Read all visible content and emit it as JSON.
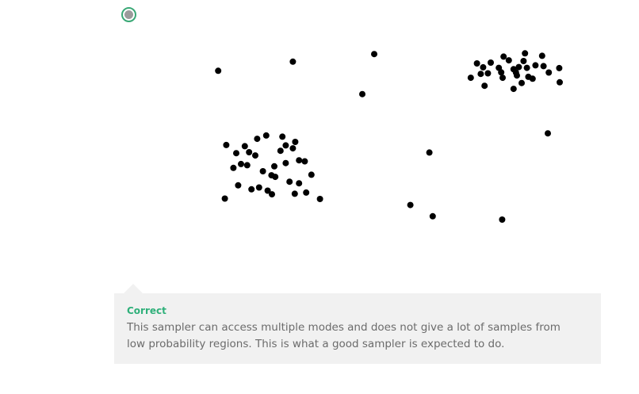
{
  "option": {
    "selected": true,
    "ring_color": "#3aa876",
    "fill_color": "#9b9b9b"
  },
  "chart_data": {
    "type": "scatter",
    "title": "",
    "xlabel": "",
    "ylabel": "",
    "xlim": [
      0,
      100
    ],
    "ylim": [
      0,
      100
    ],
    "grid": false,
    "axes_visible": false,
    "point_color": "#000000",
    "points": [
      [
        19.2,
        86.0
      ],
      [
        34.9,
        90.7
      ],
      [
        52.0,
        94.6
      ],
      [
        49.5,
        74.0
      ],
      [
        90.9,
        87.4
      ],
      [
        88.5,
        53.8
      ],
      [
        63.6,
        43.9
      ],
      [
        64.3,
        11.1
      ],
      [
        78.9,
        9.4
      ],
      [
        59.6,
        16.9
      ],
      [
        83.7,
        95.0
      ],
      [
        87.3,
        93.7
      ],
      [
        79.2,
        93.3
      ],
      [
        73.6,
        89.8
      ],
      [
        76.5,
        90.2
      ],
      [
        80.3,
        91.4
      ],
      [
        83.4,
        91.0
      ],
      [
        87.6,
        88.4
      ],
      [
        74.9,
        87.8
      ],
      [
        78.2,
        87.5
      ],
      [
        81.3,
        86.8
      ],
      [
        82.4,
        87.9
      ],
      [
        84.1,
        87.5
      ],
      [
        85.9,
        88.8
      ],
      [
        75.9,
        84.7
      ],
      [
        74.4,
        84.4
      ],
      [
        78.7,
        85.2
      ],
      [
        81.8,
        85.1
      ],
      [
        84.4,
        82.9
      ],
      [
        88.7,
        85.1
      ],
      [
        72.3,
        82.4
      ],
      [
        79.0,
        82.4
      ],
      [
        85.3,
        81.9
      ],
      [
        82.0,
        83.6
      ],
      [
        91.0,
        80.1
      ],
      [
        75.2,
        78.3
      ],
      [
        81.3,
        76.7
      ],
      [
        83.0,
        79.7
      ],
      [
        23.0,
        43.6
      ],
      [
        27.4,
        51.0
      ],
      [
        29.3,
        52.7
      ],
      [
        32.7,
        52.1
      ],
      [
        35.4,
        49.4
      ],
      [
        20.9,
        47.8
      ],
      [
        24.8,
        47.2
      ],
      [
        33.4,
        47.6
      ],
      [
        27.0,
        42.4
      ],
      [
        32.3,
        44.8
      ],
      [
        34.9,
        46.1
      ],
      [
        37.4,
        39.4
      ],
      [
        22.4,
        36.0
      ],
      [
        24.0,
        38.0
      ],
      [
        31.0,
        36.8
      ],
      [
        36.2,
        39.9
      ],
      [
        25.3,
        37.4
      ],
      [
        28.6,
        34.3
      ],
      [
        30.4,
        32.2
      ],
      [
        38.8,
        32.5
      ],
      [
        23.4,
        27.0
      ],
      [
        26.2,
        25.0
      ],
      [
        27.8,
        25.9
      ],
      [
        30.5,
        22.4
      ],
      [
        20.6,
        20.2
      ],
      [
        34.2,
        28.9
      ],
      [
        36.2,
        28.1
      ],
      [
        40.6,
        20.0
      ],
      [
        35.3,
        22.7
      ],
      [
        29.6,
        24.3
      ],
      [
        31.2,
        31.4
      ],
      [
        37.7,
        23.3
      ],
      [
        25.7,
        44.1
      ],
      [
        33.4,
        38.5
      ]
    ]
  },
  "feedback": {
    "title": "Correct",
    "line1": "This sampler can access multiple modes and does not give a lot of samples from",
    "line2": "low probability regions. This is what a good sampler is expected to do.",
    "accent_color": "#2fb07a"
  }
}
